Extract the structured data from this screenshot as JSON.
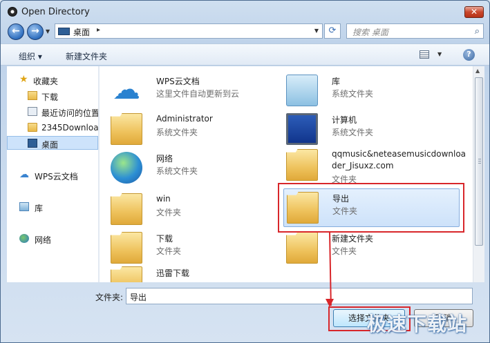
{
  "window": {
    "title": "Open Directory",
    "close_glyph": "✕"
  },
  "nav": {
    "back_glyph": "←",
    "forward_glyph": "→",
    "address": "桌面",
    "address_sep": "▸",
    "search_placeholder": "搜索 桌面"
  },
  "toolbar": {
    "organize": "组织 ▾",
    "new_folder": "新建文件夹",
    "help_glyph": "?"
  },
  "sidebar": {
    "items": [
      {
        "label": "收藏夹",
        "icon": "star-icon"
      },
      {
        "label": "下载",
        "icon": "downloads-folder-icon"
      },
      {
        "label": "最近访问的位置",
        "icon": "recent-places-icon"
      },
      {
        "label": "2345Downloads",
        "icon": "folder-icon"
      },
      {
        "label": "桌面",
        "icon": "desktop-icon",
        "selected": true
      },
      {
        "label": "WPS云文档",
        "icon": "cloud-icon"
      },
      {
        "label": "库",
        "icon": "library-icon"
      },
      {
        "label": "网络",
        "icon": "network-icon"
      }
    ]
  },
  "items": [
    {
      "name": "WPS云文档",
      "type": "这里文件自动更新到云",
      "icon": "cloud-icon"
    },
    {
      "name": "库",
      "type": "系统文件夹",
      "icon": "library-icon"
    },
    {
      "name": "Administrator",
      "type": "系统文件夹",
      "icon": "user-folder-icon"
    },
    {
      "name": "计算机",
      "type": "系统文件夹",
      "icon": "computer-icon"
    },
    {
      "name": "网络",
      "type": "系统文件夹",
      "icon": "network-icon"
    },
    {
      "name": "qqmusic&neteasemusicdownloa",
      "name2": "der_Jisuxz.com",
      "type": "文件夹",
      "icon": "folder-icon"
    },
    {
      "name": "win",
      "type": "文件夹",
      "icon": "folder-icon"
    },
    {
      "name": "导出",
      "type": "文件夹",
      "icon": "folder-icon",
      "selected": true
    },
    {
      "name": "下载",
      "type": "文件夹",
      "icon": "folder-icon"
    },
    {
      "name": "新建文件夹",
      "type": "文件夹",
      "icon": "folder-icon"
    },
    {
      "name": "迅雷下载",
      "type": "文件夹",
      "icon": "folder-icon"
    }
  ],
  "footer": {
    "folder_label": "文件夹:",
    "folder_value": "导出",
    "select_button": "选择文件夹",
    "cancel_button": "取消"
  },
  "watermark": "极速下载站",
  "colors": {
    "highlight_red": "#d8262a",
    "selection_blue": "#cde2fa"
  }
}
